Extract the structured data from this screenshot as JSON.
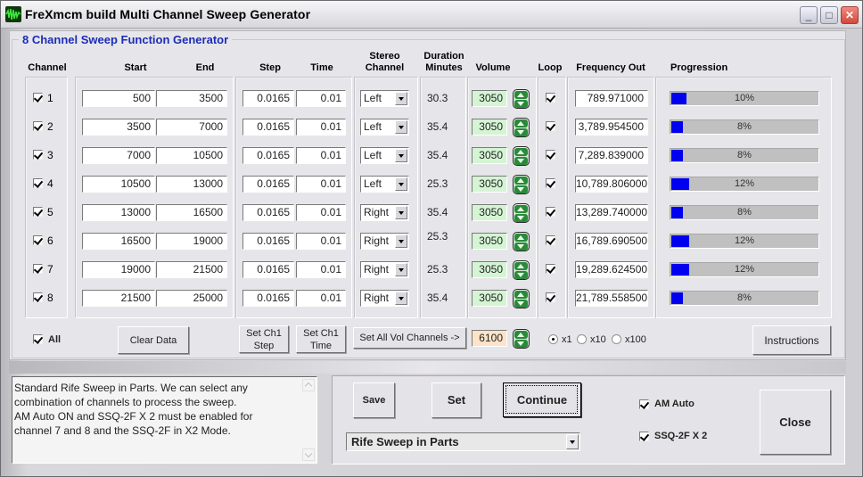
{
  "window": {
    "title": "FreXmcm build  Multi Channel Sweep Generator",
    "controls": {
      "minimize": "_",
      "maximize": "□",
      "close": "✕"
    }
  },
  "group_title": "8 Channel Sweep Function Generator",
  "headers": {
    "channel": "Channel",
    "start": "Start",
    "end": "End",
    "step": "Step",
    "time": "Time",
    "stereo_line1": "Stereo",
    "stereo_line2": "Channel",
    "duration_line1": "Duration",
    "duration_line2": "Minutes",
    "volume": "Volume",
    "loop": "Loop",
    "frequency_out": "Frequency Out",
    "progression": "Progression"
  },
  "channels": [
    {
      "num": "1",
      "enabled": true,
      "start": "500",
      "end": "3500",
      "step": "0.0165",
      "time": "0.01",
      "stereo": "Left",
      "duration": "30.3",
      "volume": "3050",
      "loop": true,
      "freq_out": "789.971000",
      "progress_pct": 10,
      "progress_label": "10%"
    },
    {
      "num": "2",
      "enabled": true,
      "start": "3500",
      "end": "7000",
      "step": "0.0165",
      "time": "0.01",
      "stereo": "Left",
      "duration": "35.4",
      "volume": "3050",
      "loop": true,
      "freq_out": "3,789.954500",
      "progress_pct": 8,
      "progress_label": "8%"
    },
    {
      "num": "3",
      "enabled": true,
      "start": "7000",
      "end": "10500",
      "step": "0.0165",
      "time": "0.01",
      "stereo": "Left",
      "duration": "35.4",
      "volume": "3050",
      "loop": true,
      "freq_out": "7,289.839000",
      "progress_pct": 8,
      "progress_label": "8%"
    },
    {
      "num": "4",
      "enabled": true,
      "start": "10500",
      "end": "13000",
      "step": "0.0165",
      "time": "0.01",
      "stereo": "Left",
      "duration": "25.3",
      "volume": "3050",
      "loop": true,
      "freq_out": "10,789.806000",
      "progress_pct": 12,
      "progress_label": "12%"
    },
    {
      "num": "5",
      "enabled": true,
      "start": "13000",
      "end": "16500",
      "step": "0.0165",
      "time": "0.01",
      "stereo": "Right",
      "duration": "35.4",
      "volume": "3050",
      "loop": true,
      "freq_out": "13,289.740000",
      "progress_pct": 8,
      "progress_label": "8%"
    },
    {
      "num": "6",
      "enabled": true,
      "start": "16500",
      "end": "19000",
      "step": "0.0165",
      "time": "0.01",
      "stereo": "Right",
      "duration": "25.3",
      "volume": "3050",
      "loop": true,
      "freq_out": "16,789.690500",
      "progress_pct": 12,
      "progress_label": "12%"
    },
    {
      "num": "7",
      "enabled": true,
      "start": "19000",
      "end": "21500",
      "step": "0.0165",
      "time": "0.01",
      "stereo": "Right",
      "duration": "25.3",
      "volume": "3050",
      "loop": true,
      "freq_out": "19,289.624500",
      "progress_pct": 12,
      "progress_label": "12%"
    },
    {
      "num": "8",
      "enabled": true,
      "start": "21500",
      "end": "25000",
      "step": "0.0165",
      "time": "0.01",
      "stereo": "Right",
      "duration": "35.4",
      "volume": "3050",
      "loop": true,
      "freq_out": "21,789.558500",
      "progress_pct": 8,
      "progress_label": "8%"
    }
  ],
  "bottom_row": {
    "all_label": "All",
    "all_checked": true,
    "clear_data": "Clear Data",
    "set_ch1_step": "Set Ch1\nStep",
    "set_ch1_time": "Set Ch1\nTime",
    "set_all_vol": "Set All Vol Channels ->",
    "all_vol_value": "6100",
    "multipliers": [
      {
        "label": "x1",
        "selected": true
      },
      {
        "label": "x10",
        "selected": false
      },
      {
        "label": "x100",
        "selected": false
      }
    ],
    "instructions": "Instructions"
  },
  "notes": "Standard Rife Sweep in Parts. We can select any\ncombination of channels to process the sweep.\nAM Auto ON and SSQ-2F X 2 must be enabled for\nchannel 7 and 8 and the SSQ-2F in X2 Mode.",
  "controls": {
    "save": "Save",
    "set": "Set",
    "continue": "Continue",
    "preset_selected": "Rife Sweep in Parts",
    "am_auto_label": "AM Auto",
    "am_auto_checked": true,
    "ssq_label": "SSQ-2F  X  2",
    "ssq_checked": true,
    "close": "Close"
  },
  "colors": {
    "group_title": "#1c2cb8",
    "progress_fill": "#0000f0",
    "volume_bg": "#d4f4d4",
    "all_vol_bg": "#fde3c8"
  }
}
